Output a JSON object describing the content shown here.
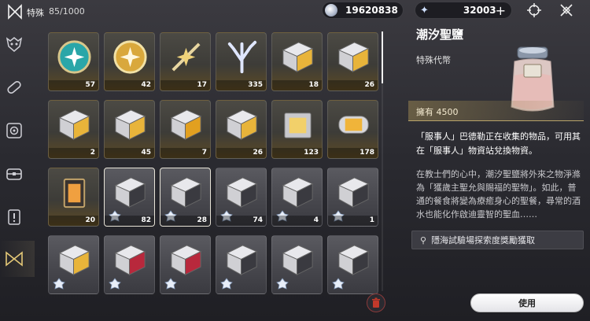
{
  "header": {
    "title": "特殊",
    "capacity": "85/1000",
    "currency_a": "19620838",
    "currency_b": "32003",
    "plus_label": "+"
  },
  "sidebar": {
    "items": [
      {
        "icon": "mask-icon"
      },
      {
        "icon": "capsule-icon"
      },
      {
        "icon": "gear-box-icon"
      },
      {
        "icon": "chest-icon"
      },
      {
        "icon": "notice-icon"
      },
      {
        "icon": "special-icon",
        "active": true
      }
    ]
  },
  "grid": {
    "items": [
      {
        "name": "teal-orb",
        "count": "57",
        "rarity": "gold"
      },
      {
        "name": "gold-orb",
        "count": "42",
        "rarity": "gold"
      },
      {
        "name": "star-sword",
        "count": "17",
        "rarity": "gold"
      },
      {
        "name": "coral-crystal",
        "count": "335",
        "rarity": "gold"
      },
      {
        "name": "gold-cube",
        "count": "18",
        "rarity": "gold"
      },
      {
        "name": "gold-cube-b",
        "count": "26",
        "rarity": "gold"
      },
      {
        "name": "gold-box",
        "count": "2",
        "rarity": "gold"
      },
      {
        "name": "gold-box-b",
        "count": "45",
        "rarity": "gold"
      },
      {
        "name": "amber-cube",
        "count": "7",
        "rarity": "gold"
      },
      {
        "name": "gold-box-c",
        "count": "26",
        "rarity": "gold"
      },
      {
        "name": "silver-crate",
        "count": "123",
        "rarity": "gold"
      },
      {
        "name": "capsule-tank",
        "count": "178",
        "rarity": "gold"
      },
      {
        "name": "lantern",
        "count": "20",
        "rarity": "gold"
      },
      {
        "name": "silver-box",
        "count": "82",
        "rarity": "plain",
        "selected": true
      },
      {
        "name": "silver-box-b",
        "count": "28",
        "rarity": "plain",
        "selected": true
      },
      {
        "name": "silver-box-c",
        "count": "74",
        "rarity": "plain"
      },
      {
        "name": "silver-box-d",
        "count": "4",
        "rarity": "plain"
      },
      {
        "name": "silver-box-e",
        "count": "1",
        "rarity": "plain"
      },
      {
        "name": "gold-box-d",
        "count": "",
        "rarity": "plain"
      },
      {
        "name": "red-box",
        "count": "",
        "rarity": "plain"
      },
      {
        "name": "red-box-b",
        "count": "",
        "rarity": "plain"
      },
      {
        "name": "silver-box-f",
        "count": "",
        "rarity": "plain"
      },
      {
        "name": "silver-box-g",
        "count": "",
        "rarity": "plain"
      },
      {
        "name": "silver-box-h",
        "count": "",
        "rarity": "plain"
      }
    ]
  },
  "detail": {
    "title": "潮汐聖鹽",
    "type": "特殊代幣",
    "owned": "擁有 4500",
    "desc_primary": "「服事人」巴德勒正在收集的物品，可用其在「服事人」物資站兌換物資。",
    "desc_secondary": "在教士們的心中，潮汐聖鹽將外來之物淨滌為「獲歲主聖允與賜福的聖物」。如此，普通的餐食將變為療癒身心的聖餐，尋常的酒水也能化作啟迪靈智的聖血……",
    "source": "隱海試驗場探索度獎勵獲取",
    "use_button": "使用"
  },
  "colors": {
    "accent_gold": "#b8a36a",
    "delete_red": "#c0392b"
  }
}
